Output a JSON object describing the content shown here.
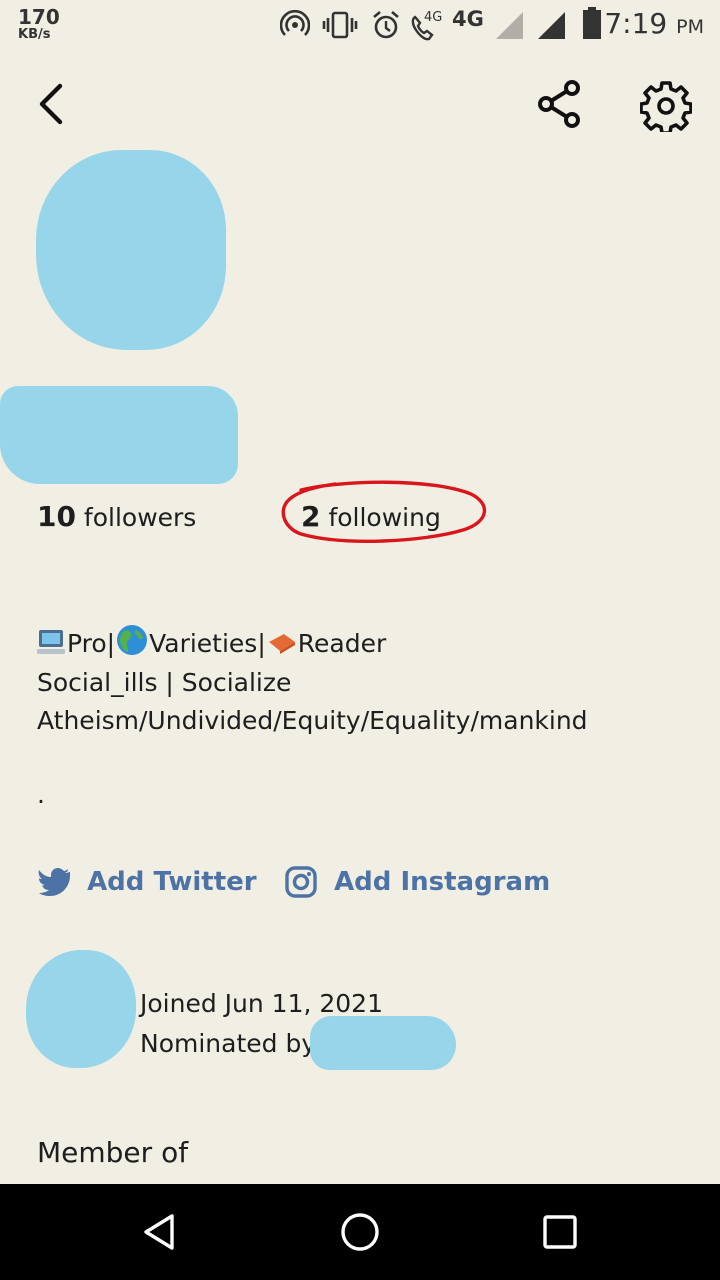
{
  "status_bar": {
    "net_speed": "170",
    "net_speed_unit": "KB/s",
    "network_small": "4G",
    "network": "4G",
    "time": "7:19",
    "ampm": "PM",
    "icons": [
      "hotspot-icon",
      "vibrate-icon",
      "alarm-icon",
      "volte-call-icon",
      "signal-icon",
      "signal-icon",
      "battery-icon"
    ]
  },
  "top_nav": {
    "icons": [
      "back-icon",
      "share-icon",
      "settings-icon"
    ]
  },
  "profile": {
    "followers_count": "10",
    "followers_label": "followers",
    "following_count": "2",
    "following_label": "following",
    "bio": {
      "seg1": "Pro|",
      "seg2": "Varieties|",
      "seg3": "Reader",
      "line2": "Social_ills | Socialize",
      "line3": "Atheism/Undivided/Equity/Equality/mankind",
      "line4": "."
    },
    "add_twitter": "Add Twitter",
    "add_instagram": "Add Instagram",
    "joined": "Joined Jun 11, 2021",
    "nominated_by": "Nominated by",
    "member_of": "Member of"
  },
  "colors": {
    "background": "#f1eee4",
    "link": "#4d72a5",
    "annotation": "#d9161c",
    "redaction": "#97d5ea"
  }
}
